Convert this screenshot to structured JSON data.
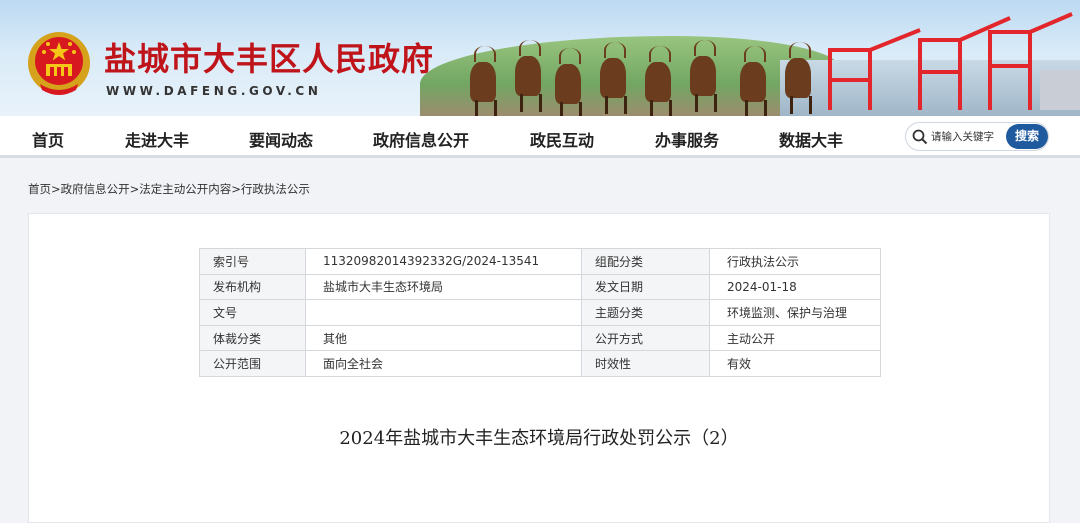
{
  "header": {
    "site_title": "盐城市大丰区人民政府",
    "site_url": "WWW.DAFENG.GOV.CN"
  },
  "nav": {
    "items": [
      "首页",
      "走进大丰",
      "要闻动态",
      "政府信息公开",
      "政民互动",
      "办事服务",
      "数据大丰"
    ],
    "search_placeholder": "请输入关键字",
    "search_button": "搜索"
  },
  "breadcrumb": [
    "首页",
    "政府信息公开",
    "法定主动公开内容",
    "行政执法公示"
  ],
  "breadcrumb_sep": ">",
  "meta": {
    "rows": [
      {
        "l1": "索引号",
        "v1": "11320982014392332G/2024-13541",
        "l2": "组配分类",
        "v2": "行政执法公示"
      },
      {
        "l1": "发布机构",
        "v1": "盐城市大丰生态环境局",
        "l2": "发文日期",
        "v2": "2024-01-18"
      },
      {
        "l1": "文号",
        "v1": "",
        "l2": "主题分类",
        "v2": "环境监测、保护与治理"
      },
      {
        "l1": "体裁分类",
        "v1": "其他",
        "l2": "公开方式",
        "v2": "主动公开"
      },
      {
        "l1": "公开范围",
        "v1": "面向全社会",
        "l2": "时效性",
        "v2": "有效"
      }
    ]
  },
  "doc": {
    "title": "2024年盐城市大丰生态环境局行政处罚公示（2）"
  },
  "colors": {
    "brand_red": "#c0141b",
    "search_blue": "#1f5a9e"
  }
}
